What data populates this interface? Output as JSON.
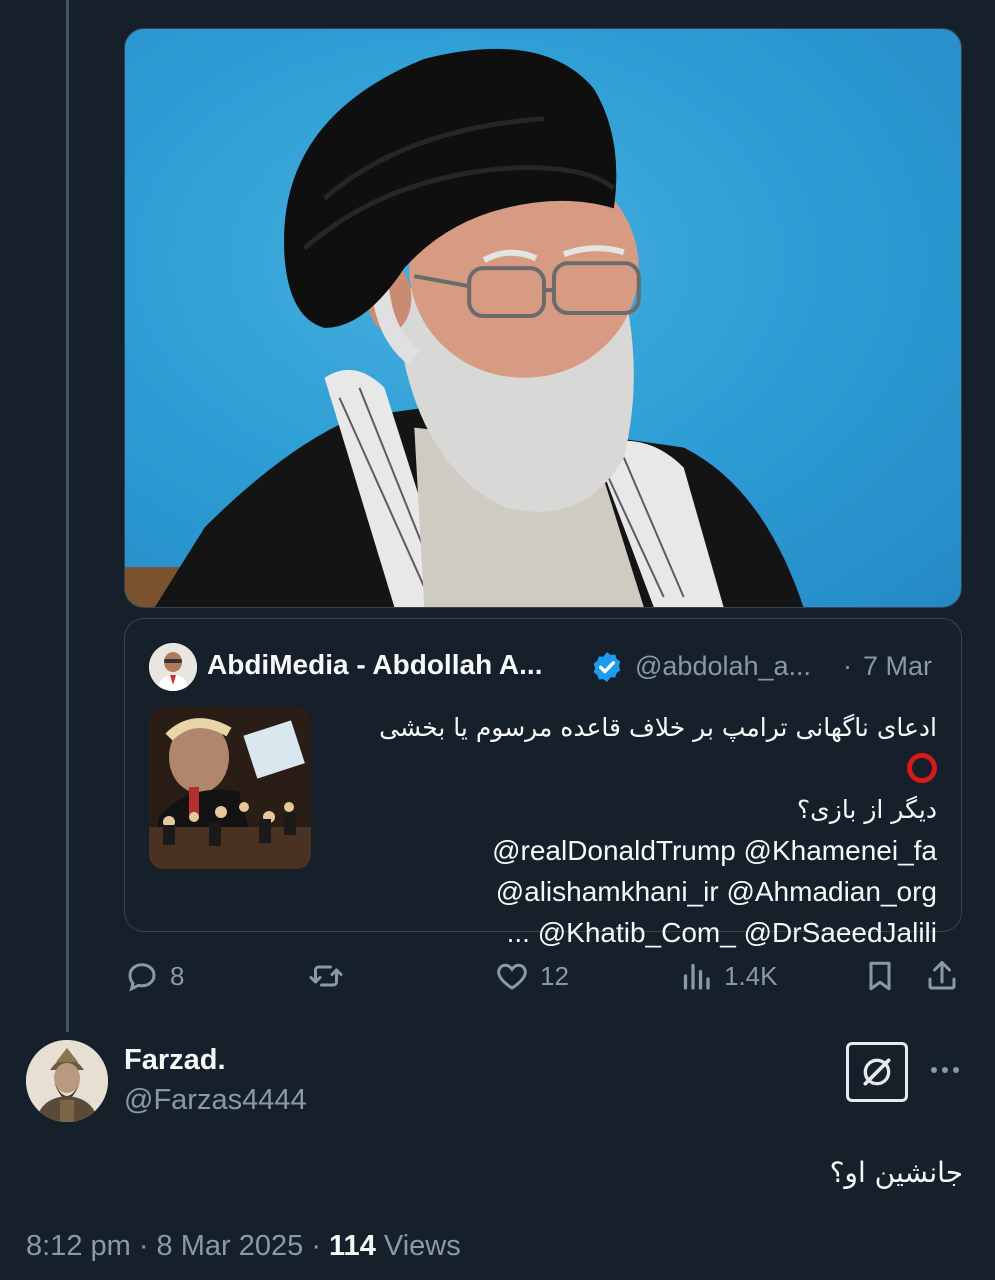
{
  "quoted_tweet": {
    "author_name": "AbdiMedia - Abdollah A...",
    "handle": "@abdolah_a...",
    "separator": "·",
    "date": "7 Mar",
    "text_rtl_line1": "ادعای ناگهانی ترامپ بر خلاف قاعده مرسوم یا بخشی",
    "text_rtl_line2": "دیگر از بازی؟",
    "mentions_line1": "@realDonaldTrump @Khamenei_fa",
    "mentions_line2": "@alishamkhani_ir @Ahmadian_org",
    "mentions_line3": "... @Khatib_Com_ @DrSaeedJalili"
  },
  "actions": {
    "replies": "8",
    "likes": "12",
    "views": "1.4K"
  },
  "reply": {
    "name": "Farzad.",
    "handle": "@Farzas4444",
    "text": "جانشین او؟"
  },
  "meta": {
    "time": "8:12 pm · 8 Mar 2025 · ",
    "views_count": "114",
    "views_label": " Views"
  },
  "colors": {
    "background": "#15202b",
    "border": "#38444d",
    "muted_text": "#8b98a5",
    "primary_text": "#f7f9f9",
    "verified_blue": "#1d9bf0"
  }
}
